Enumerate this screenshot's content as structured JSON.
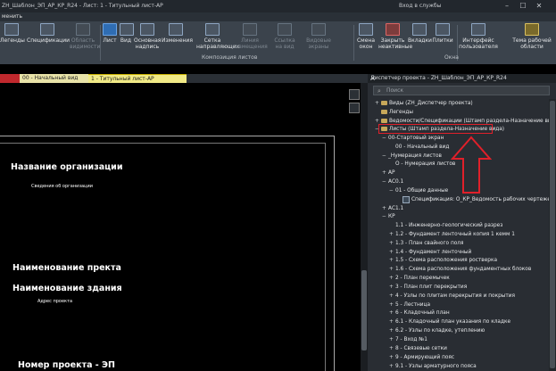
{
  "window": {
    "title": "ZH_Шаблон_ЭП_АР_КР_R24 - Лист: 1 - Титульный лист-АР",
    "login": "Вход в службы"
  },
  "menu": {
    "fragment": "менить"
  },
  "ribbon": {
    "buttons": [
      {
        "label": "Легенды",
        "enabled": true
      },
      {
        "label": "Спецификации",
        "enabled": true
      },
      {
        "label": "Область видимости",
        "enabled": false
      },
      {
        "label": "Лист",
        "enabled": true
      },
      {
        "label": "Вид",
        "enabled": true
      },
      {
        "label": "Основная надпись",
        "enabled": true
      },
      {
        "label": "Изменения",
        "enabled": true
      },
      {
        "label": "Сетка направляющих",
        "enabled": true
      },
      {
        "label": "Линия совмещения",
        "enabled": false
      },
      {
        "label": "Ссылка на вид",
        "enabled": false
      },
      {
        "label": "Видовые экраны",
        "enabled": false
      },
      {
        "label": "Смена окон",
        "enabled": true
      },
      {
        "label": "Закрыть неактивные",
        "enabled": true
      },
      {
        "label": "Вкладки",
        "enabled": true
      },
      {
        "label": "Плитки",
        "enabled": true
      },
      {
        "label": "Интерфейс пользователя",
        "enabled": true
      },
      {
        "label": "Тема рабочей области",
        "enabled": true
      }
    ],
    "groups": [
      "Композиция листов",
      "Окна"
    ]
  },
  "tabs": [
    {
      "label": ""
    },
    {
      "label": "00 - Начальный вид"
    },
    {
      "label": "1 - Титульный лист-АР"
    }
  ],
  "drawing": {
    "org_name": "Название организации",
    "org_info": "Сведения об организации",
    "project_name": "Наименование пректа",
    "building_name": "Наименование здания",
    "project_address": "Адрес проекта",
    "project_number": "Номер проекта - ЭП"
  },
  "project_browser": {
    "title": "Диспетчер проекта - ZH_Шаблон_ЭП_АР_КР_R24",
    "search_placeholder": "Поиск",
    "tree": [
      {
        "exp": "+",
        "label": "Виды (ZH_Диспетчер проекта)"
      },
      {
        "exp": "",
        "label": "Легенды"
      },
      {
        "exp": "+",
        "label": "Ведомости/Спецификации (Штамп раздела-Назначение вида)"
      },
      {
        "exp": "−",
        "label": "Листы (Штамп раздела-Назначение вида)"
      },
      {
        "exp": "−",
        "label": "00-Стартовый экран"
      },
      {
        "exp": "",
        "label": "00 - Начальный вид"
      },
      {
        "exp": "−",
        "label": "_Нумерация листов"
      },
      {
        "exp": "",
        "label": "О - Нумерация листов"
      },
      {
        "exp": "+",
        "label": "АР"
      },
      {
        "exp": "−",
        "label": "АС0.1"
      },
      {
        "exp": "−",
        "label": "01 - Общие данные"
      },
      {
        "exp": "",
        "label": "Спецификация: О_КР_Ведомость рабочих чертежей осн"
      },
      {
        "exp": "+",
        "label": "АС1.1"
      },
      {
        "exp": "−",
        "label": "КР"
      },
      {
        "exp": "",
        "label": "1.1 - Инженерно-геологический разрез"
      },
      {
        "exp": "+",
        "label": "1.2 - Фундамент ленточный копия 1 кемм 1"
      },
      {
        "exp": "+",
        "label": "1.3 - План свайного поля"
      },
      {
        "exp": "+",
        "label": "1.4 - Фундамент ленточный"
      },
      {
        "exp": "+",
        "label": "1.5 - Схема расположения ростверка"
      },
      {
        "exp": "+",
        "label": "1.6 - Схема расположения фундаментных блоков"
      },
      {
        "exp": "+",
        "label": "2 - План перемычек"
      },
      {
        "exp": "+",
        "label": "3 - План плит перекрытия"
      },
      {
        "exp": "+",
        "label": "4 - Узлы по плитам перекрытия и покрытия"
      },
      {
        "exp": "+",
        "label": "5 - Лестница"
      },
      {
        "exp": "+",
        "label": "6 - Кладочный план"
      },
      {
        "exp": "+",
        "label": "6.1 - Кладочный план указания по кладке"
      },
      {
        "exp": "+",
        "label": "6.2 - Узлы по кладке, утеплению"
      },
      {
        "exp": "+",
        "label": "7 - Вход №1"
      },
      {
        "exp": "+",
        "label": "8 - Связевые сетки"
      },
      {
        "exp": "+",
        "label": "9 - Армирующий пояс"
      },
      {
        "exp": "+",
        "label": "9.1 - Узлы арматурного пояса"
      }
    ]
  },
  "colors": {
    "highlight": "#e0202a",
    "active_tab": "#f1ea86",
    "ribbon_bg": "#3b434c"
  }
}
